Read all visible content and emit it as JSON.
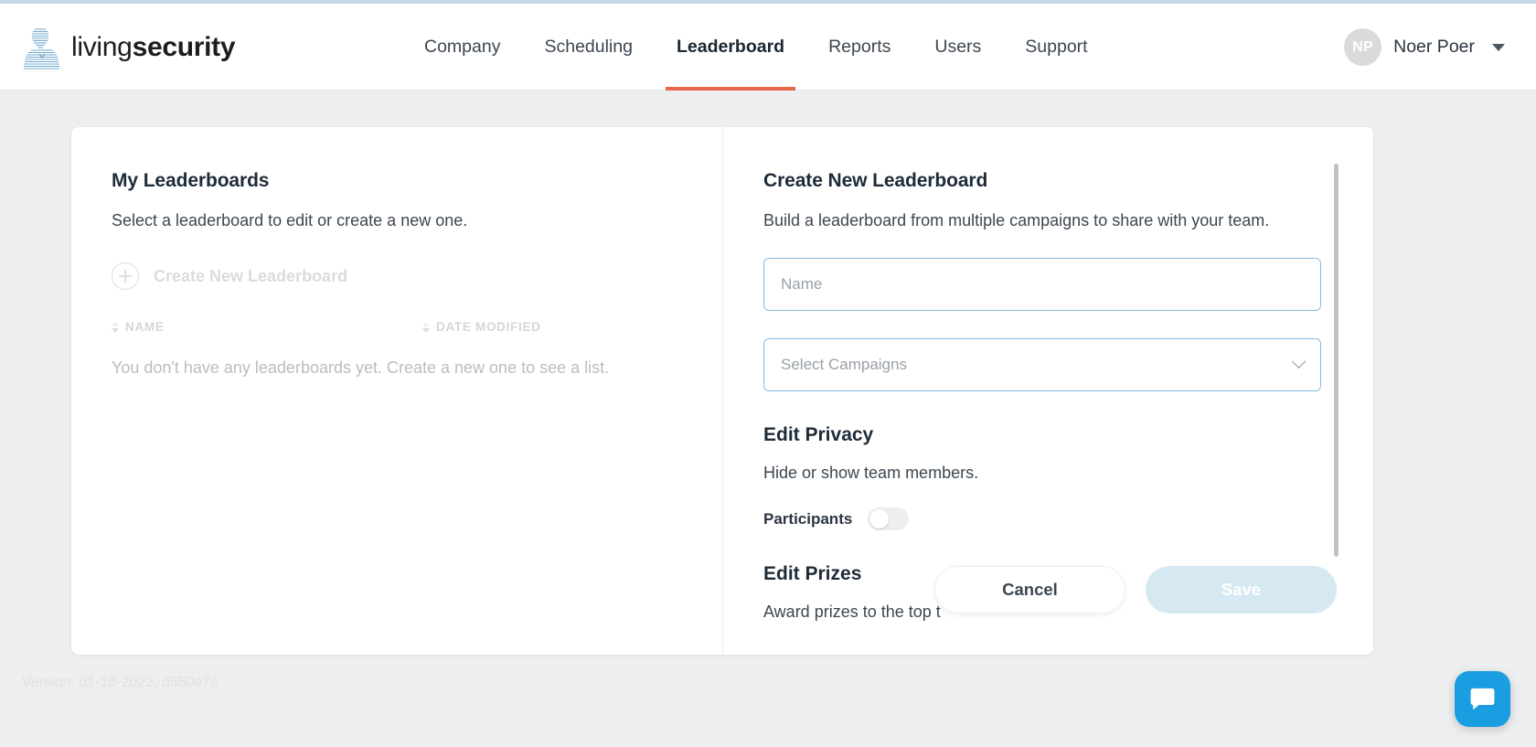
{
  "header": {
    "logo": {
      "icon": "person-linework-logo-icon",
      "text_light": "living",
      "text_bold": "security"
    },
    "nav": [
      {
        "label": "Company",
        "active": false
      },
      {
        "label": "Scheduling",
        "active": false
      },
      {
        "label": "Leaderboard",
        "active": true
      },
      {
        "label": "Reports",
        "active": false
      },
      {
        "label": "Users",
        "active": false
      },
      {
        "label": "Support",
        "active": false
      }
    ],
    "user": {
      "initials": "NP",
      "name": "Noer Poer",
      "caret": "caret-down-icon"
    },
    "accent_color": "#e8664a"
  },
  "left_panel": {
    "title": "My Leaderboards",
    "subtitle": "Select a leaderboard to edit or create a new one.",
    "create_new_label": "Create New Leaderboard",
    "create_new_icon": "plus-circle-icon",
    "columns": [
      {
        "label": "NAME"
      },
      {
        "label": "DATE MODIFIED"
      }
    ],
    "empty_message": "You don't have any leaderboards yet. Create a new one to see a list."
  },
  "right_panel": {
    "title": "Create New Leaderboard",
    "subtitle": "Build a leaderboard from multiple campaigns to share with your team.",
    "name_field": {
      "placeholder": "Name",
      "value": ""
    },
    "campaigns_field": {
      "placeholder": "Select Campaigns",
      "value": "",
      "icon": "chevron-down-icon"
    },
    "privacy": {
      "title": "Edit Privacy",
      "subtitle": "Hide or show team members.",
      "toggle_label": "Participants",
      "toggle_state": "off"
    },
    "prizes": {
      "title": "Edit Prizes",
      "subtitle": "Award prizes to the top t"
    }
  },
  "actions": {
    "cancel_label": "Cancel",
    "save_label": "Save",
    "save_disabled": true
  },
  "footer": {
    "version": "Version: 01-18-2022, d550e7c"
  },
  "chat": {
    "icon": "chat-bubble-icon",
    "color": "#1b9de2"
  }
}
